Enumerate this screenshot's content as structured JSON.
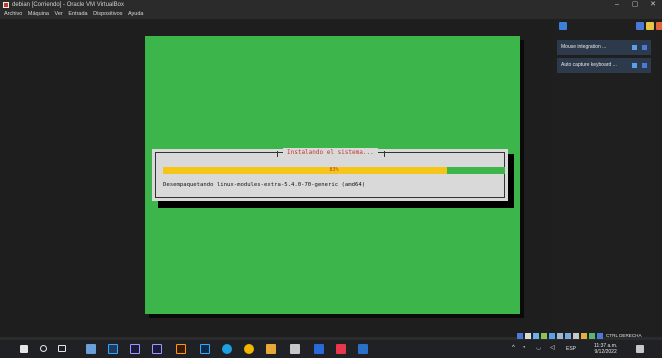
{
  "window": {
    "title": "debian [Corriendo] - Oracle VM VirtualBox",
    "controls": {
      "minimize": "–",
      "maximize": "▢",
      "close": "✕"
    }
  },
  "menu": [
    "Archivo",
    "Máquina",
    "Ver",
    "Entrada",
    "Dispositivos",
    "Ayuda"
  ],
  "installer": {
    "title": "Instalando el sistema...",
    "progress_fraction": 0.83,
    "progress_label": "83%",
    "status_text": "Desempaquetando linux-modules-extra-5.4.0-70-generic (amd64)"
  },
  "notifications": [
    {
      "text": "Mouse integration ..."
    },
    {
      "text": "Auto capture keyboard ..."
    }
  ],
  "vbox_status": {
    "host_key": "CTRL DERECHA"
  },
  "tray": {
    "language": "ESP",
    "time": "11:37 a.m.",
    "date": "9/12/2022"
  },
  "colors": {
    "installer_bg": "#3cb54a",
    "progress_fill": "#f5c518",
    "dialog_title": "#c0392b"
  }
}
